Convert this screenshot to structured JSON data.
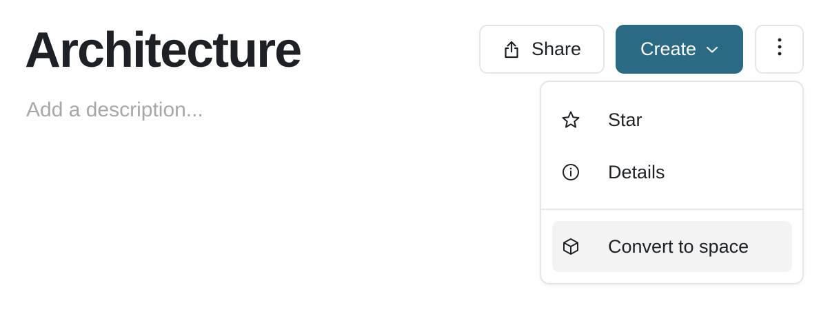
{
  "page": {
    "title": "Architecture",
    "description_placeholder": "Add a description..."
  },
  "toolbar": {
    "share_label": "Share",
    "create_label": "Create",
    "share_icon": "share-icon",
    "create_dropdown_icon": "chevron-down-icon",
    "more_icon": "more-vertical-icon"
  },
  "menu": {
    "items": [
      {
        "label": "Star",
        "icon": "star-icon"
      },
      {
        "label": "Details",
        "icon": "info-icon"
      },
      {
        "label": "Convert to space",
        "icon": "cube-icon"
      }
    ]
  },
  "colors": {
    "primary": "#2b6a84",
    "text": "#1d2125",
    "placeholder": "#a4a7ab",
    "border": "#e3e5e8",
    "menu_hover": "#f3f3f4"
  }
}
